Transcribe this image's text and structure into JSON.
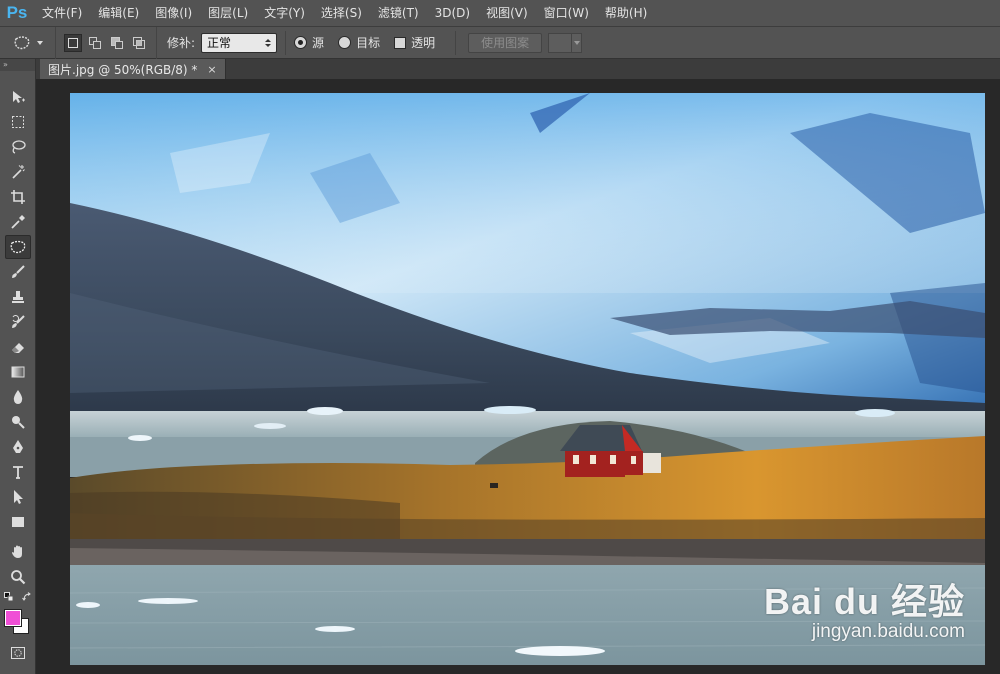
{
  "app": {
    "logo": "Ps"
  },
  "menu": [
    "文件(F)",
    "编辑(E)",
    "图像(I)",
    "图层(L)",
    "文字(Y)",
    "选择(S)",
    "滤镜(T)",
    "3D(D)",
    "视图(V)",
    "窗口(W)",
    "帮助(H)"
  ],
  "options": {
    "patch_label": "修补:",
    "patch_value": "正常",
    "radio_source": "源",
    "radio_target": "目标",
    "transparent": "透明",
    "use_pattern": "使用图案",
    "selected_radio": "源",
    "transparent_checked": false
  },
  "document": {
    "tab_title": "图片.jpg @ 50%(RGB/8) *",
    "close": "×"
  },
  "watermark": {
    "brand": "Bai du 经验",
    "url": "jingyan.baidu.com"
  },
  "colors": {
    "foreground": "#f04fd6",
    "background": "#ffffff",
    "accent": "#4ab5f0"
  },
  "tools": [
    "move-icon",
    "marquee-icon",
    "lasso-icon",
    "magic-wand-icon",
    "crop-icon",
    "eyedropper-icon",
    "patch-tool-icon",
    "brush-icon",
    "stamp-icon",
    "history-brush-icon",
    "eraser-icon",
    "gradient-icon",
    "blur-icon",
    "dodge-icon",
    "pen-icon",
    "type-icon",
    "path-select-icon",
    "rectangle-icon",
    "hand-icon",
    "zoom-icon"
  ],
  "active_tool": "patch-tool-icon"
}
